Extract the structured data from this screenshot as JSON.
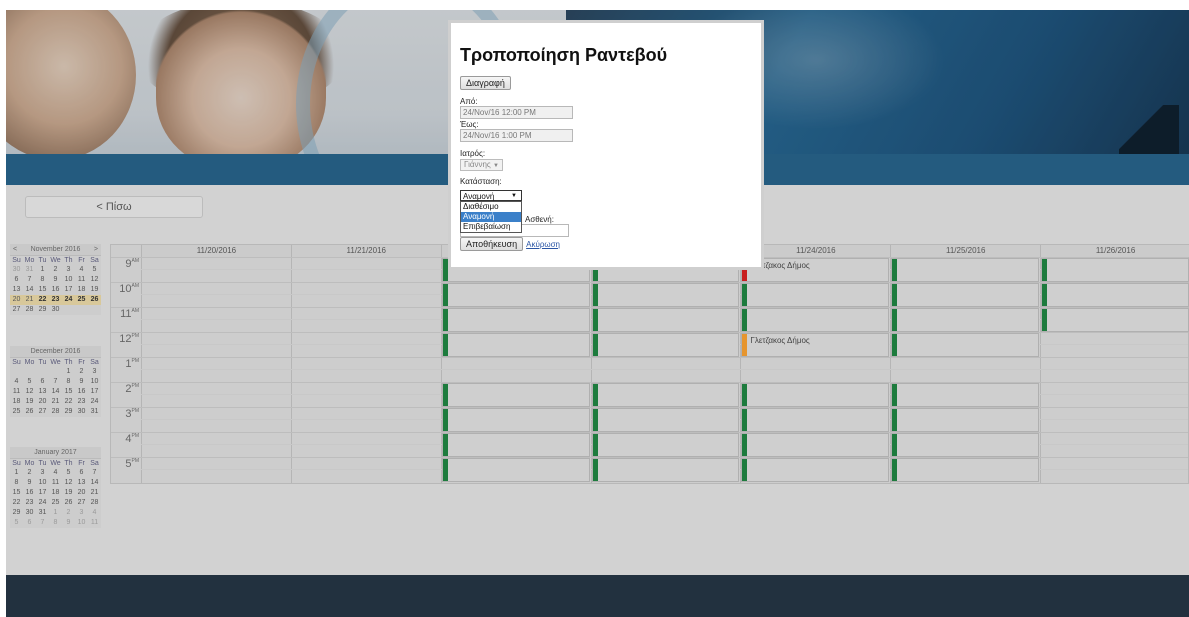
{
  "nav": {
    "back_label": "< Πίσω"
  },
  "mini_calendars": [
    {
      "title": "November 2016",
      "prev": "<",
      "next": ">",
      "dow": [
        "Su",
        "Mo",
        "Tu",
        "We",
        "Th",
        "Fr",
        "Sa"
      ],
      "weeks": [
        [
          {
            "d": "30",
            "m": "o"
          },
          {
            "d": "31",
            "m": "o"
          },
          {
            "d": "1"
          },
          {
            "d": "2"
          },
          {
            "d": "3"
          },
          {
            "d": "4"
          },
          {
            "d": "5"
          }
        ],
        [
          {
            "d": "6"
          },
          {
            "d": "7"
          },
          {
            "d": "8"
          },
          {
            "d": "9"
          },
          {
            "d": "10"
          },
          {
            "d": "11"
          },
          {
            "d": "12"
          }
        ],
        [
          {
            "d": "13"
          },
          {
            "d": "14"
          },
          {
            "d": "15"
          },
          {
            "d": "16"
          },
          {
            "d": "17"
          },
          {
            "d": "18"
          },
          {
            "d": "19"
          }
        ],
        [
          {
            "d": "20",
            "m": "s"
          },
          {
            "d": "21",
            "m": "s"
          },
          {
            "d": "22",
            "m": "b"
          },
          {
            "d": "23",
            "m": "b"
          },
          {
            "d": "24",
            "m": "b"
          },
          {
            "d": "25",
            "m": "b"
          },
          {
            "d": "26",
            "m": "b"
          }
        ],
        [
          {
            "d": "27"
          },
          {
            "d": "28"
          },
          {
            "d": "29"
          },
          {
            "d": "30"
          }
        ]
      ]
    },
    {
      "title": "December 2016",
      "dow": [
        "Su",
        "Mo",
        "Tu",
        "We",
        "Th",
        "Fr",
        "Sa"
      ],
      "weeks": [
        [
          {
            "d": ""
          },
          {
            "d": ""
          },
          {
            "d": ""
          },
          {
            "d": ""
          },
          {
            "d": ""
          },
          {
            "d": "1"
          },
          {
            "d": "2"
          },
          {
            "d": "3"
          }
        ],
        [
          {
            "d": "4"
          },
          {
            "d": "5"
          },
          {
            "d": "6"
          },
          {
            "d": "7"
          },
          {
            "d": "8"
          },
          {
            "d": "9"
          },
          {
            "d": "10"
          }
        ],
        [
          {
            "d": "11"
          },
          {
            "d": "12"
          },
          {
            "d": "13"
          },
          {
            "d": "14"
          },
          {
            "d": "15"
          },
          {
            "d": "16"
          },
          {
            "d": "17"
          }
        ],
        [
          {
            "d": "18"
          },
          {
            "d": "19"
          },
          {
            "d": "20"
          },
          {
            "d": "21"
          },
          {
            "d": "22"
          },
          {
            "d": "23"
          },
          {
            "d": "24"
          }
        ],
        [
          {
            "d": "25"
          },
          {
            "d": "26"
          },
          {
            "d": "27"
          },
          {
            "d": "28"
          },
          {
            "d": "29"
          },
          {
            "d": "30"
          },
          {
            "d": "31"
          }
        ]
      ]
    },
    {
      "title": "January 2017",
      "dow": [
        "Su",
        "Mo",
        "Tu",
        "We",
        "Th",
        "Fr",
        "Sa"
      ],
      "weeks": [
        [
          {
            "d": "1"
          },
          {
            "d": "2"
          },
          {
            "d": "3"
          },
          {
            "d": "4"
          },
          {
            "d": "5"
          },
          {
            "d": "6"
          },
          {
            "d": "7"
          }
        ],
        [
          {
            "d": "8"
          },
          {
            "d": "9"
          },
          {
            "d": "10"
          },
          {
            "d": "11"
          },
          {
            "d": "12"
          },
          {
            "d": "13"
          },
          {
            "d": "14"
          }
        ],
        [
          {
            "d": "15"
          },
          {
            "d": "16"
          },
          {
            "d": "17"
          },
          {
            "d": "18"
          },
          {
            "d": "19"
          },
          {
            "d": "20"
          },
          {
            "d": "21"
          }
        ],
        [
          {
            "d": "22"
          },
          {
            "d": "23"
          },
          {
            "d": "24"
          },
          {
            "d": "25"
          },
          {
            "d": "26"
          },
          {
            "d": "27"
          },
          {
            "d": "28"
          }
        ],
        [
          {
            "d": "29"
          },
          {
            "d": "30"
          },
          {
            "d": "31"
          },
          {
            "d": "1",
            "m": "o"
          },
          {
            "d": "2",
            "m": "o"
          },
          {
            "d": "3",
            "m": "o"
          },
          {
            "d": "4",
            "m": "o"
          }
        ],
        [
          {
            "d": "5",
            "m": "o"
          },
          {
            "d": "6",
            "m": "o"
          },
          {
            "d": "7",
            "m": "o"
          },
          {
            "d": "8",
            "m": "o"
          },
          {
            "d": "9",
            "m": "o"
          },
          {
            "d": "10",
            "m": "o"
          },
          {
            "d": "11",
            "m": "o"
          }
        ]
      ]
    }
  ],
  "calendar": {
    "days": [
      "11/20/2016",
      "11/21/2016",
      "11/22/2016",
      "11/23/2016",
      "11/24/2016",
      "11/25/2016",
      "11/26/2016"
    ],
    "hours": [
      {
        "n": "9",
        "ampm": "AM"
      },
      {
        "n": "10",
        "ampm": "AM"
      },
      {
        "n": "11",
        "ampm": "AM"
      },
      {
        "n": "12",
        "ampm": "PM"
      },
      {
        "n": "1",
        "ampm": "PM"
      },
      {
        "n": "2",
        "ampm": "PM"
      },
      {
        "n": "3",
        "ampm": "PM"
      },
      {
        "n": "4",
        "ampm": "PM"
      },
      {
        "n": "5",
        "ampm": "PM"
      }
    ],
    "appointments": [
      {
        "day": 2,
        "hour": 0,
        "color": "green"
      },
      {
        "day": 2,
        "hour": 1,
        "color": "green"
      },
      {
        "day": 2,
        "hour": 2,
        "color": "green"
      },
      {
        "day": 2,
        "hour": 3,
        "color": "green"
      },
      {
        "day": 2,
        "hour": 5,
        "color": "green"
      },
      {
        "day": 2,
        "hour": 6,
        "color": "green"
      },
      {
        "day": 2,
        "hour": 7,
        "color": "green"
      },
      {
        "day": 2,
        "hour": 8,
        "color": "green"
      },
      {
        "day": 3,
        "hour": 0,
        "color": "green"
      },
      {
        "day": 3,
        "hour": 1,
        "color": "green"
      },
      {
        "day": 3,
        "hour": 2,
        "color": "green"
      },
      {
        "day": 3,
        "hour": 3,
        "color": "green"
      },
      {
        "day": 3,
        "hour": 5,
        "color": "green"
      },
      {
        "day": 3,
        "hour": 6,
        "color": "green"
      },
      {
        "day": 3,
        "hour": 7,
        "color": "green"
      },
      {
        "day": 3,
        "hour": 8,
        "color": "green"
      },
      {
        "day": 4,
        "hour": 0,
        "color": "red",
        "name": "Γλετζακος Δήμος"
      },
      {
        "day": 4,
        "hour": 1,
        "color": "green"
      },
      {
        "day": 4,
        "hour": 2,
        "color": "green"
      },
      {
        "day": 4,
        "hour": 3,
        "color": "orange",
        "name": "Γλετζακος Δήμος"
      },
      {
        "day": 4,
        "hour": 5,
        "color": "green"
      },
      {
        "day": 4,
        "hour": 6,
        "color": "green"
      },
      {
        "day": 4,
        "hour": 7,
        "color": "green"
      },
      {
        "day": 4,
        "hour": 8,
        "color": "green"
      },
      {
        "day": 5,
        "hour": 0,
        "color": "green"
      },
      {
        "day": 5,
        "hour": 1,
        "color": "green"
      },
      {
        "day": 5,
        "hour": 2,
        "color": "green"
      },
      {
        "day": 5,
        "hour": 3,
        "color": "green"
      },
      {
        "day": 5,
        "hour": 5,
        "color": "green"
      },
      {
        "day": 5,
        "hour": 6,
        "color": "green"
      },
      {
        "day": 5,
        "hour": 7,
        "color": "green"
      },
      {
        "day": 5,
        "hour": 8,
        "color": "green"
      },
      {
        "day": 6,
        "hour": 0,
        "color": "green"
      },
      {
        "day": 6,
        "hour": 1,
        "color": "green"
      },
      {
        "day": 6,
        "hour": 2,
        "color": "green"
      }
    ],
    "colors": {
      "green": "#1d7b3d",
      "red": "#c81e1e",
      "orange": "#e6952e"
    }
  },
  "modal": {
    "title": "Τροποποίηση Ραντεβού",
    "delete_label": "Διαγραφή",
    "from_label": "Από:",
    "from_value": "24/Nov/16 12:00 PM",
    "to_label": "Έως:",
    "to_value": "24/Nov/16 1:00 PM",
    "doctor_label": "Ιατρός:",
    "doctor_value": "Γιάννης",
    "status_label": "Κατάσταση:",
    "status_value": "Αναμονή",
    "status_options": [
      "Διαθέσιμο",
      "Αναμονή",
      "Επιβεβαίωση"
    ],
    "status_highlighted": 1,
    "patient_label": "Ασθενή:",
    "save_label": "Αποθήκευση",
    "cancel_label": "Ακύρωση"
  }
}
